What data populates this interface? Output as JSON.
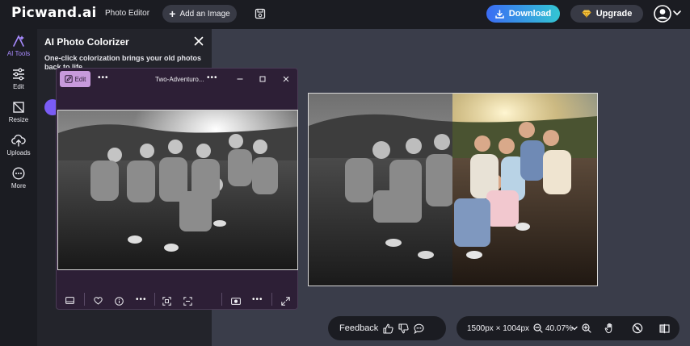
{
  "app": {
    "logo_main": "Picwand",
    "logo_suffix": ".ai",
    "nav_photo_editor": "Photo Editor",
    "add_image_label": "Add an Image",
    "download_label": "Download",
    "upgrade_label": "Upgrade"
  },
  "rail": [
    {
      "label": "AI Tools",
      "icon": "ai-tools-icon",
      "active": true
    },
    {
      "label": "Edit",
      "icon": "sliders-icon",
      "active": false
    },
    {
      "label": "Resize",
      "icon": "crop-icon",
      "active": false
    },
    {
      "label": "Uploads",
      "icon": "cloud-upload-icon",
      "active": false
    },
    {
      "label": "More",
      "icon": "more-icon",
      "active": false
    }
  ],
  "panel": {
    "title": "AI Photo Colorizer",
    "description": "One-click colorization brings your old photos back to life."
  },
  "viewer": {
    "edit_label": "Edit",
    "filename": "Two-Adventuro..."
  },
  "feedback": {
    "label": "Feedback"
  },
  "zoom": {
    "dimensions": "1500px × 1004px",
    "level": "40.07%"
  },
  "colors": {
    "topbar_bg": "#1b1c22",
    "canvas_bg": "#3a3d4a",
    "accent_purple": "#7a5cf5",
    "download_from": "#3b6cf4",
    "download_to": "#33c5d3",
    "viewer_bg": "#2d1f36",
    "viewer_edit_bg": "#c79adc"
  }
}
